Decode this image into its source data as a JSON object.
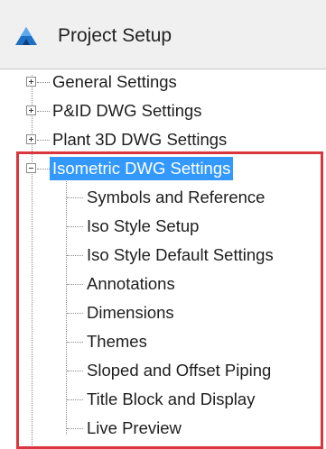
{
  "header": {
    "app_icon": "autocad-plant-logo-icon",
    "title": "Project Setup"
  },
  "tree": {
    "nodes": [
      {
        "label": "General Settings",
        "expander": "plus",
        "selected": false
      },
      {
        "label": "P&ID DWG Settings",
        "expander": "plus",
        "selected": false
      },
      {
        "label": "Plant 3D DWG Settings",
        "expander": "plus",
        "selected": false
      },
      {
        "label": "Isometric DWG Settings",
        "expander": "minus",
        "selected": true
      }
    ],
    "children": [
      {
        "label": "Symbols and Reference"
      },
      {
        "label": "Iso Style Setup"
      },
      {
        "label": "Iso Style Default Settings"
      },
      {
        "label": "Annotations"
      },
      {
        "label": "Dimensions"
      },
      {
        "label": "Themes"
      },
      {
        "label": "Sloped and Offset Piping"
      },
      {
        "label": "Title Block and Display"
      },
      {
        "label": "Live Preview"
      }
    ]
  },
  "colors": {
    "selection": "#3399ff",
    "highlight_border": "#d9363e"
  }
}
